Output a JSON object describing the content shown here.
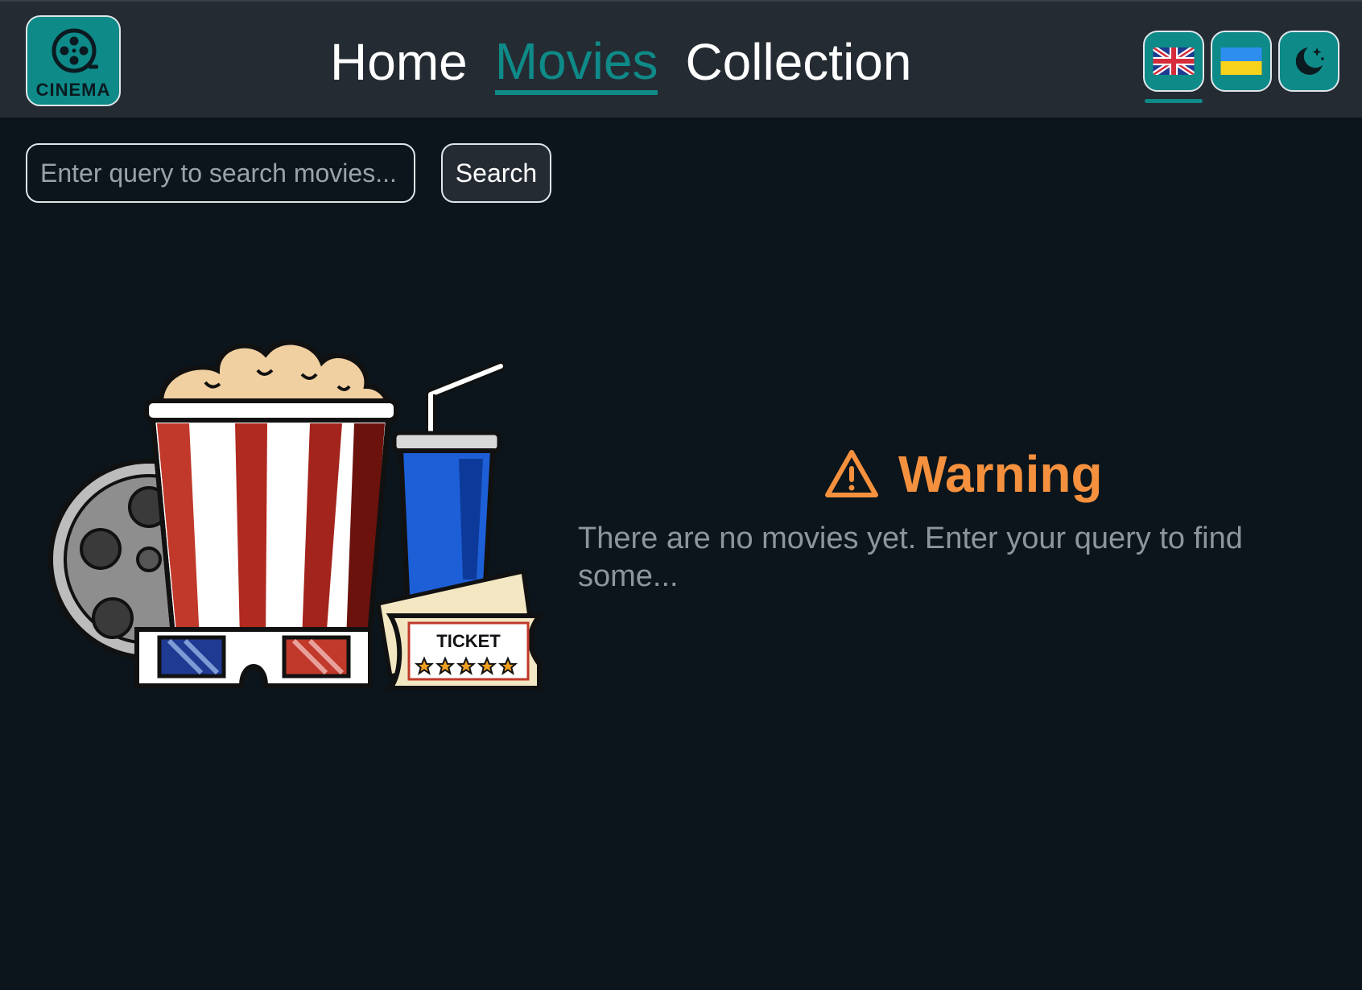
{
  "header": {
    "logo_text": "CINEMA",
    "logo_icon": "film-reel-icon",
    "nav": [
      {
        "label": "Home",
        "active": false
      },
      {
        "label": "Movies",
        "active": true
      },
      {
        "label": "Collection",
        "active": false
      }
    ],
    "language_buttons": [
      {
        "icon": "uk-flag-icon",
        "active": true
      },
      {
        "icon": "ukraine-flag-icon",
        "active": false
      }
    ],
    "theme_toggle_icon": "moon-stars-icon"
  },
  "search": {
    "placeholder": "Enter query to search movies...",
    "value": "",
    "button_label": "Search"
  },
  "illustration": {
    "ticket_text": "TICKET",
    "ticket_stars": 5
  },
  "warning": {
    "icon": "warning-triangle-icon",
    "title": "Warning",
    "message": "There are no movies yet. Enter your query to find some..."
  },
  "colors": {
    "accent": "#0e8a88",
    "header_bg": "#252b33",
    "page_bg": "#0b151b",
    "warning": "#f5913e",
    "muted_text": "#8d969d"
  }
}
